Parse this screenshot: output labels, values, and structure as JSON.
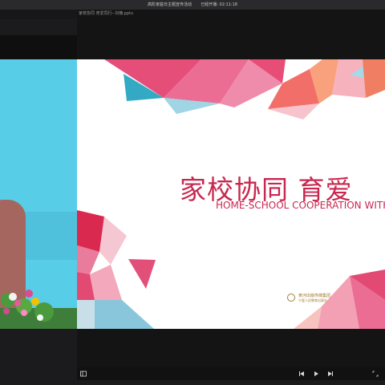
{
  "window": {
    "meeting_title": "高阶家庭日主题宣传活动",
    "elapsed": "已经开播: 02:11:18",
    "file_title": "家校协同 育爱同行--刘楠.pptx"
  },
  "slide": {
    "title_cn": "家校协同  育爱",
    "title_en": "HOME-SCHOOL COOPERATION WITH",
    "publisher_line1": "黄河出版传媒集团",
    "publisher_line2": "宁夏人民教育出版社"
  },
  "controls": {
    "sidebar_icon": "sidebar-toggle-icon",
    "prev_icon": "previous-icon",
    "play_icon": "play-icon",
    "next_icon": "next-icon",
    "expand_icon": "expand-icon"
  },
  "colors": {
    "accent": "#c8274f",
    "publisher": "#a07a2c",
    "camera_wall": "#58cde8"
  }
}
